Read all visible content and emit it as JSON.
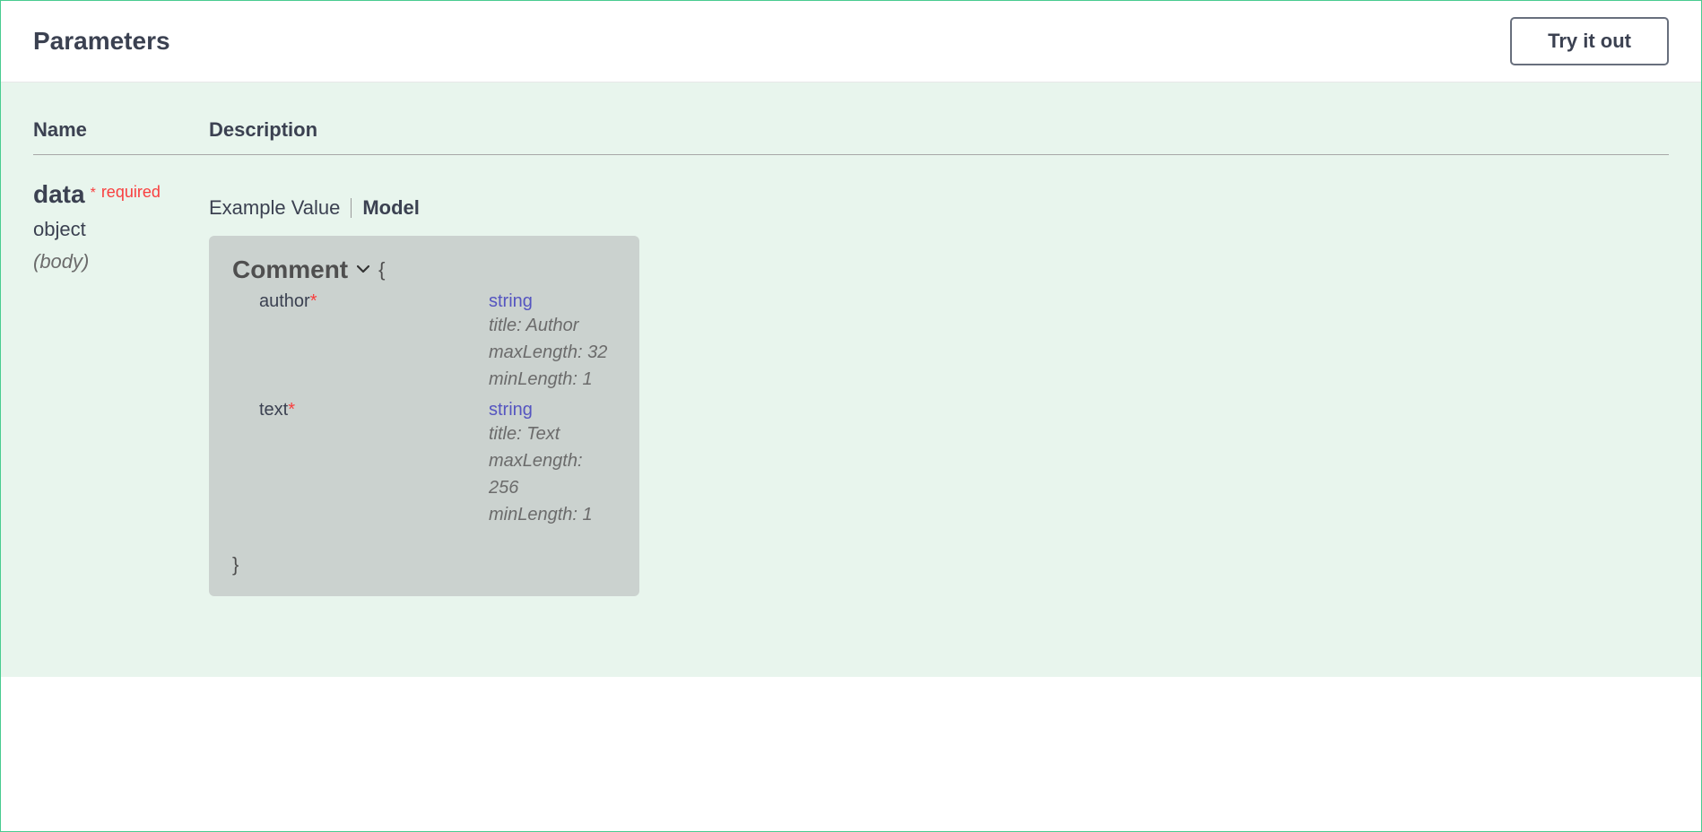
{
  "header": {
    "title": "Parameters",
    "try_button": "Try it out"
  },
  "columns": {
    "name": "Name",
    "description": "Description"
  },
  "parameter": {
    "name": "data",
    "required_star": "*",
    "required_label": "required",
    "type": "object",
    "location": "(body)",
    "tabs": {
      "example": "Example Value",
      "model": "Model"
    },
    "model": {
      "title": "Comment",
      "open_brace": "{",
      "close_brace": "}",
      "properties": [
        {
          "name": "author",
          "required": "*",
          "type": "string",
          "meta": [
            "title: Author",
            "maxLength: 32",
            "minLength: 1"
          ]
        },
        {
          "name": "text",
          "required": "*",
          "type": "string",
          "meta": [
            "title: Text",
            "maxLength: 256",
            "minLength: 1"
          ]
        }
      ]
    }
  }
}
